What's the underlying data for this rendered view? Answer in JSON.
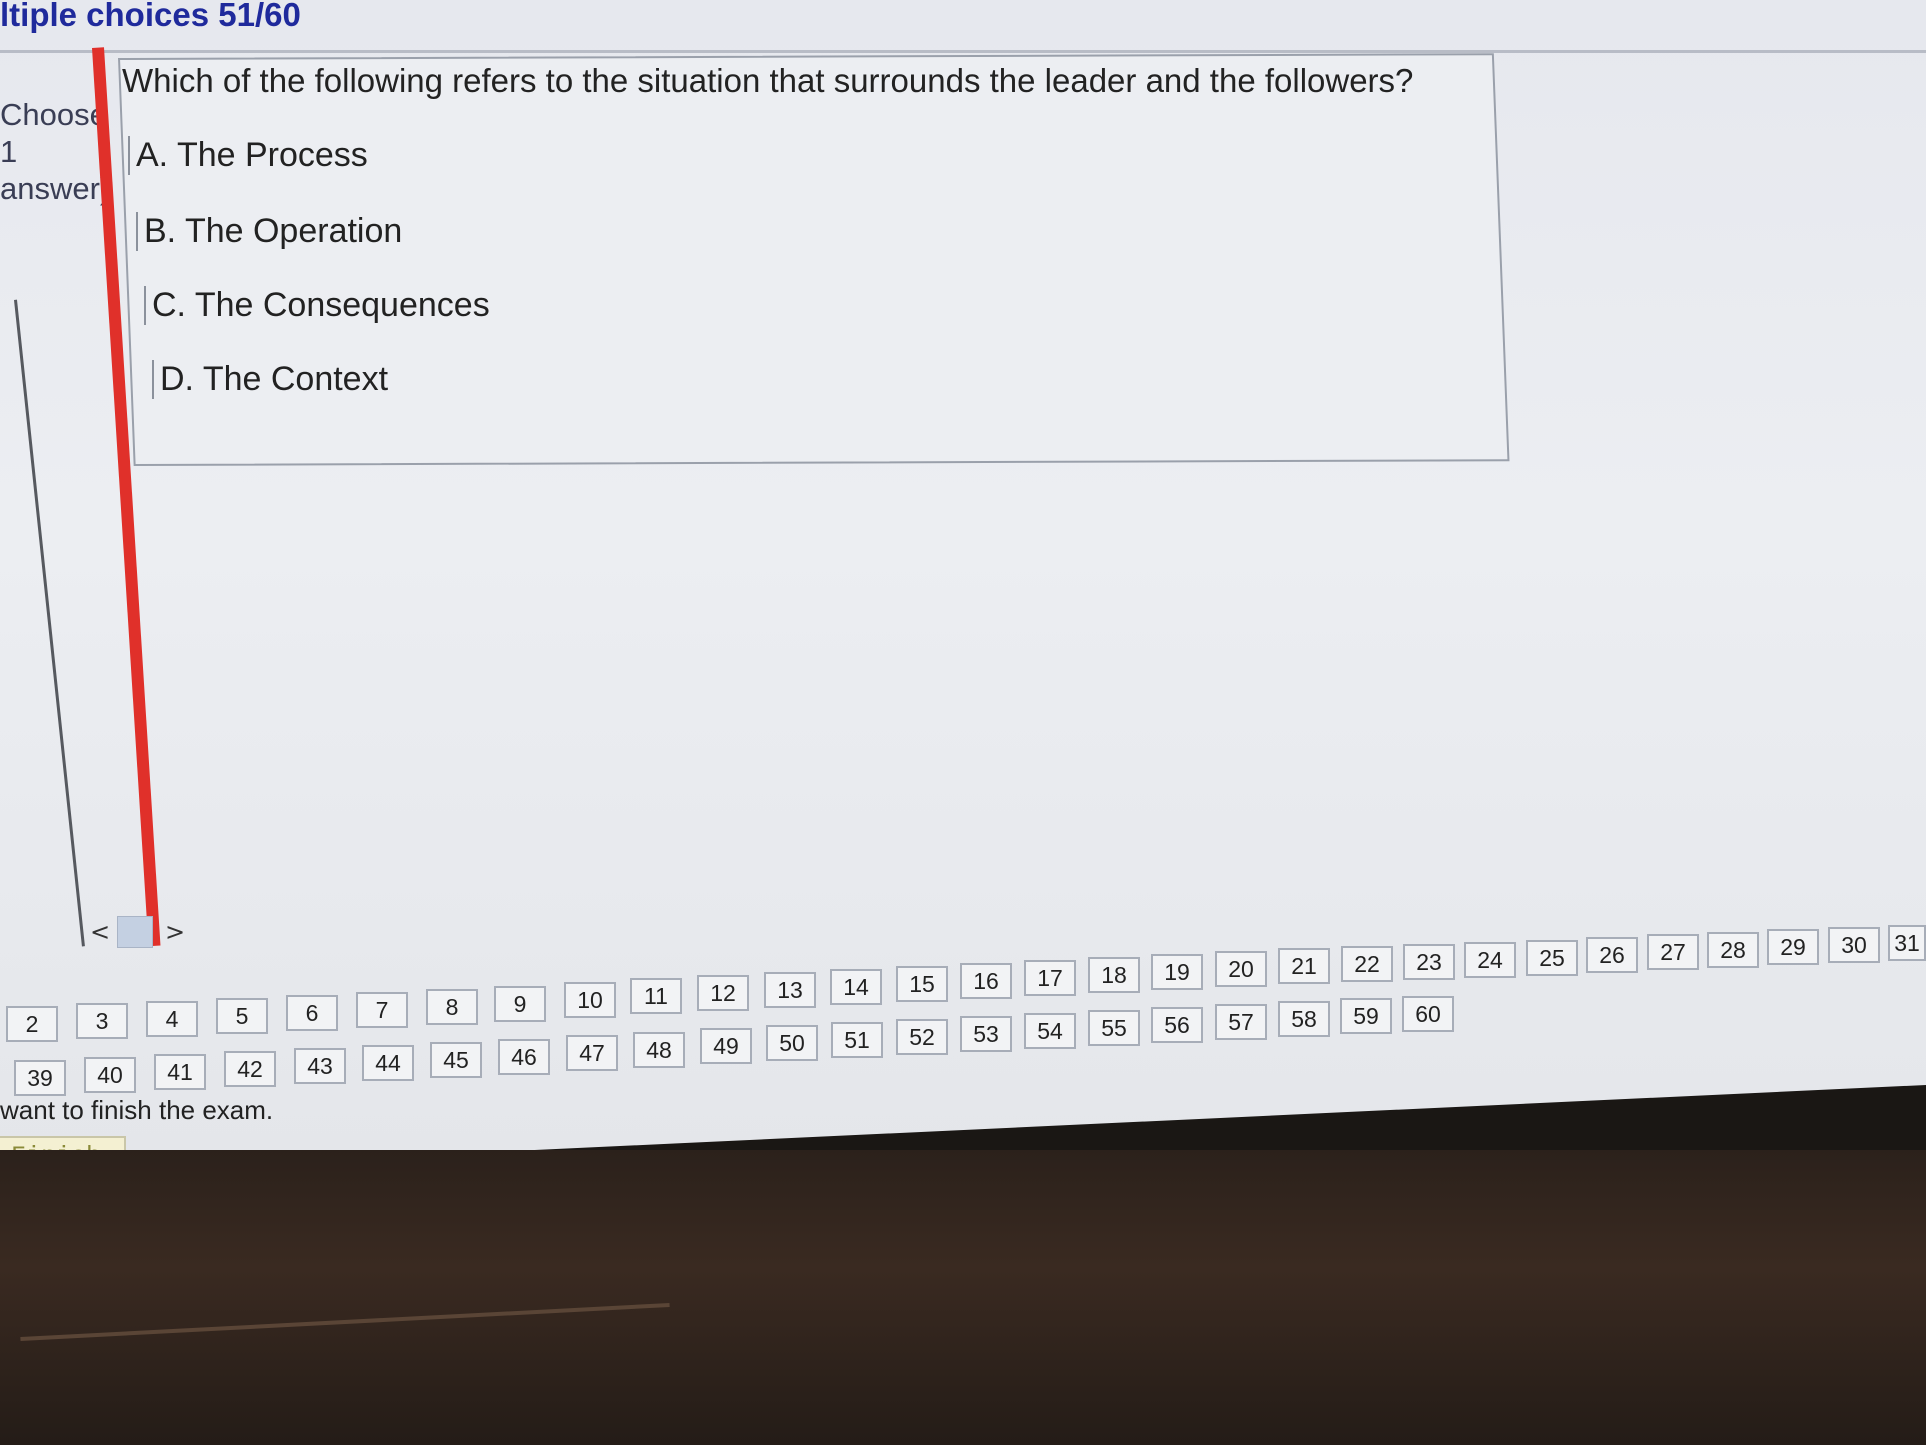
{
  "header": {
    "title": "ltiple choices 51/60"
  },
  "sidebar": {
    "label_lines": [
      "Choose",
      "1",
      "answer)"
    ]
  },
  "question": {
    "text": "Which of the following refers to the situation that surrounds the leader and the followers?",
    "options": [
      {
        "label": "A. The Process"
      },
      {
        "label": "B. The Operation"
      },
      {
        "label": "C. The Consequences"
      },
      {
        "label": "D. The Context"
      }
    ]
  },
  "nav": {
    "prev": "<",
    "next": ">"
  },
  "question_grid": {
    "row1": [
      "24",
      "25",
      "26",
      "27",
      "28",
      "29",
      "30",
      "31"
    ],
    "row1b": [
      "10",
      "11",
      "12",
      "13",
      "14",
      "15",
      "16",
      "17",
      "18",
      "19",
      "20",
      "21",
      "22",
      "23"
    ],
    "row2": [
      "2",
      "3",
      "4",
      "5",
      "6",
      "7",
      "8",
      "9"
    ],
    "row2b": [
      "47",
      "48",
      "49",
      "50",
      "51",
      "52",
      "53",
      "54",
      "55",
      "56",
      "57",
      "58",
      "59",
      "60"
    ],
    "row3": [
      "39",
      "40",
      "41",
      "42",
      "43",
      "44",
      "45",
      "46"
    ]
  },
  "footer": {
    "message": "want to finish the exam.",
    "finish_label": "Finish"
  }
}
